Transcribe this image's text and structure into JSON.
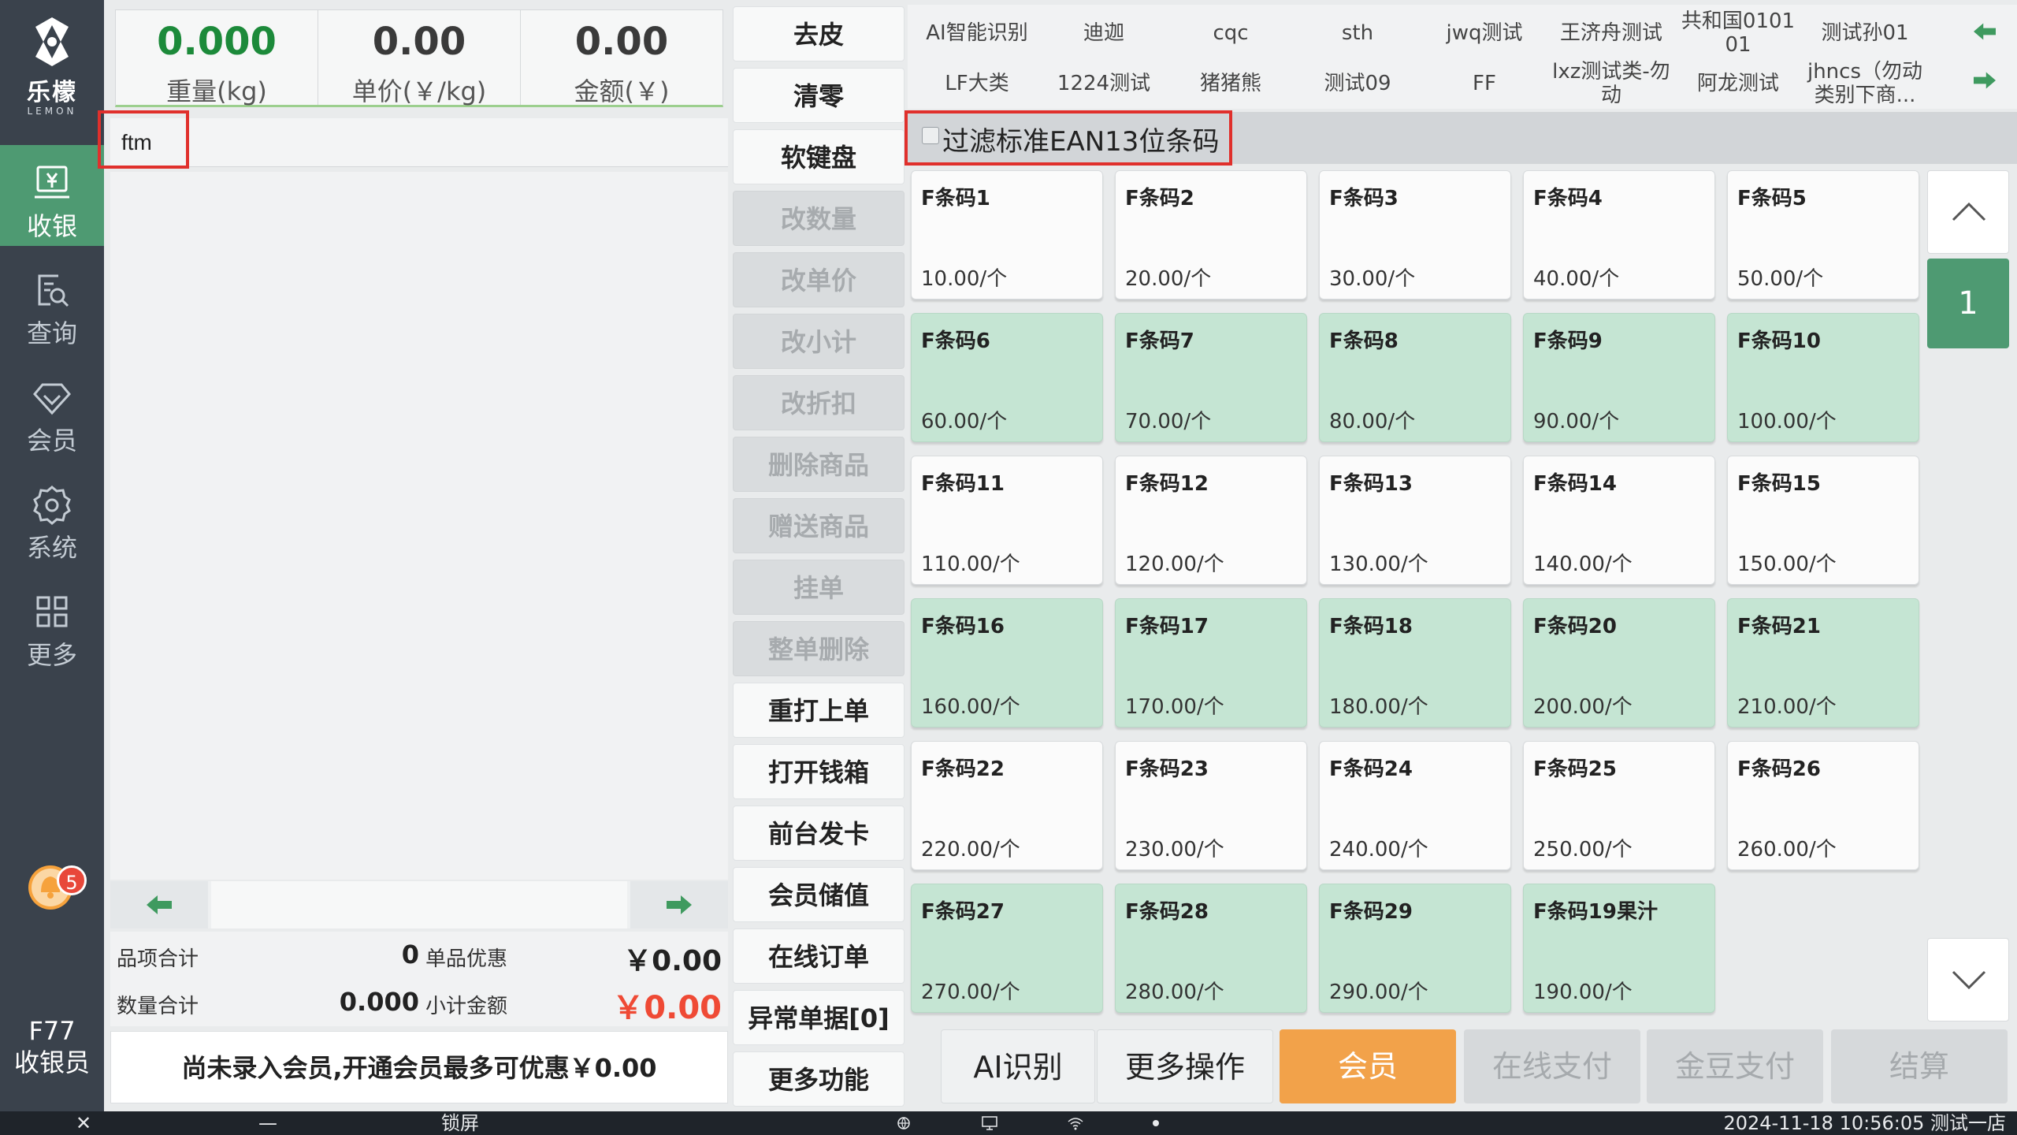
{
  "app": {
    "brand_name": "乐檬",
    "brand_sub": "LEMON",
    "notification_count": "5",
    "operator_code": "F77",
    "operator_role": "收银员"
  },
  "nav": {
    "items": [
      {
        "label": "收银",
        "icon": "cashier-icon",
        "active": true
      },
      {
        "label": "查询",
        "icon": "search-doc-icon",
        "active": false
      },
      {
        "label": "会员",
        "icon": "diamond-icon",
        "active": false
      },
      {
        "label": "系统",
        "icon": "gear-icon",
        "active": false
      },
      {
        "label": "更多",
        "icon": "grid-icon",
        "active": false
      }
    ]
  },
  "scale": {
    "weight_value": "0.000",
    "weight_label": "重量(kg)",
    "unit_price_value": "0.00",
    "unit_price_label": "单价(￥/kg)",
    "amount_value": "0.00",
    "amount_label": "金额(￥)"
  },
  "search": {
    "value": "ftm"
  },
  "totals": {
    "items_label": "品项合计",
    "items_value": "0",
    "discount_label": "单品优惠",
    "discount_value": "￥0.00",
    "qty_label": "数量合计",
    "qty_value": "0.000",
    "subtotal_label": "小计金额",
    "subtotal_value": "￥0.00"
  },
  "member_tip": "尚未录入会员,开通会员最多可优惠￥0.00",
  "functions": [
    {
      "label": "去皮",
      "enabled": true
    },
    {
      "label": "清零",
      "enabled": true
    },
    {
      "label": "软键盘",
      "enabled": true
    },
    {
      "label": "改数量",
      "enabled": false
    },
    {
      "label": "改单价",
      "enabled": false
    },
    {
      "label": "改小计",
      "enabled": false
    },
    {
      "label": "改折扣",
      "enabled": false
    },
    {
      "label": "删除商品",
      "enabled": false
    },
    {
      "label": "赠送商品",
      "enabled": false
    },
    {
      "label": "挂单",
      "enabled": false
    },
    {
      "label": "整单删除",
      "enabled": false
    },
    {
      "label": "重打上单",
      "enabled": true
    },
    {
      "label": "打开钱箱",
      "enabled": true
    },
    {
      "label": "前台发卡",
      "enabled": true
    },
    {
      "label": "会员储值",
      "enabled": true
    },
    {
      "label": "在线订单",
      "enabled": true
    },
    {
      "label": "异常单据[0]",
      "enabled": true
    },
    {
      "label": "更多功能",
      "enabled": true
    }
  ],
  "categories": {
    "row1": [
      "AI智能识别",
      "迪迦",
      "cqc",
      "sth",
      "jwq测试",
      "王济舟测试",
      "共和国0101 01",
      "测试孙01"
    ],
    "row2": [
      "LF大类",
      "1224测试",
      "猪猪熊",
      "测试09",
      "FF",
      "lxz测试类-勿动",
      "阿龙测试",
      "jhncs（勿动类别下商..."
    ]
  },
  "filter": {
    "label": "过滤标准EAN13位条码",
    "checked": false
  },
  "products": [
    {
      "name": "F条码1",
      "price": "10.00/个",
      "highlight": false
    },
    {
      "name": "F条码2",
      "price": "20.00/个",
      "highlight": false
    },
    {
      "name": "F条码3",
      "price": "30.00/个",
      "highlight": false
    },
    {
      "name": "F条码4",
      "price": "40.00/个",
      "highlight": false
    },
    {
      "name": "F条码5",
      "price": "50.00/个",
      "highlight": false
    },
    {
      "name": "F条码6",
      "price": "60.00/个",
      "highlight": true
    },
    {
      "name": "F条码7",
      "price": "70.00/个",
      "highlight": true
    },
    {
      "name": "F条码8",
      "price": "80.00/个",
      "highlight": true
    },
    {
      "name": "F条码9",
      "price": "90.00/个",
      "highlight": true
    },
    {
      "name": "F条码10",
      "price": "100.00/个",
      "highlight": true
    },
    {
      "name": "F条码11",
      "price": "110.00/个",
      "highlight": false
    },
    {
      "name": "F条码12",
      "price": "120.00/个",
      "highlight": false
    },
    {
      "name": "F条码13",
      "price": "130.00/个",
      "highlight": false
    },
    {
      "name": "F条码14",
      "price": "140.00/个",
      "highlight": false
    },
    {
      "name": "F条码15",
      "price": "150.00/个",
      "highlight": false
    },
    {
      "name": "F条码16",
      "price": "160.00/个",
      "highlight": true
    },
    {
      "name": "F条码17",
      "price": "170.00/个",
      "highlight": true
    },
    {
      "name": "F条码18",
      "price": "180.00/个",
      "highlight": true
    },
    {
      "name": "F条码20",
      "price": "200.00/个",
      "highlight": true
    },
    {
      "name": "F条码21",
      "price": "210.00/个",
      "highlight": true
    },
    {
      "name": "F条码22",
      "price": "220.00/个",
      "highlight": false
    },
    {
      "name": "F条码23",
      "price": "230.00/个",
      "highlight": false
    },
    {
      "name": "F条码24",
      "price": "240.00/个",
      "highlight": false
    },
    {
      "name": "F条码25",
      "price": "250.00/个",
      "highlight": false
    },
    {
      "name": "F条码26",
      "price": "260.00/个",
      "highlight": false
    },
    {
      "name": "F条码27",
      "price": "270.00/个",
      "highlight": true
    },
    {
      "name": "F条码28",
      "price": "280.00/个",
      "highlight": true
    },
    {
      "name": "F条码29",
      "price": "290.00/个",
      "highlight": true
    },
    {
      "name": "F条码19果汁",
      "price": "190.00/个",
      "highlight": true
    }
  ],
  "pagination": {
    "current_page": "1"
  },
  "actions": [
    {
      "label": "AI识别",
      "style": "light"
    },
    {
      "label": "更多操作",
      "style": "light"
    },
    {
      "label": "会员",
      "style": "orange"
    },
    {
      "label": "在线支付",
      "style": "disabled"
    },
    {
      "label": "金豆支付",
      "style": "disabled"
    },
    {
      "label": "结算",
      "style": "disabled"
    }
  ],
  "statusbar": {
    "close_glyph": "✕",
    "minimize_glyph": "—",
    "lock_label": "锁屏",
    "datetime_store": "2024-11-18 10:56:05 测试一店"
  },
  "colors": {
    "nav_bg": "#3a424c",
    "accent_green": "#4e9a72",
    "card_green": "#c5e5d3",
    "member_orange": "#f2a24a",
    "subtotal_red": "#ef4a35",
    "highlight_red": "#e0302c"
  }
}
